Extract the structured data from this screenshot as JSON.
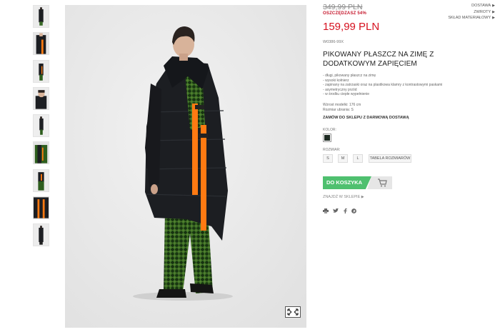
{
  "product": {
    "old_price": "349,99 PLN",
    "savings": "OSZCZĘDZASZ 54%",
    "price": "159,99 PLN",
    "sku": "W0386-99X",
    "title": "PIKOWANY PŁASZCZ NA ZIMĘ Z DODATKOWYM ZAPIĘCIEM",
    "features": [
      "długi, pikowany płaszcz na zimę",
      "wysoki kołnierz",
      "zapinany na zatrzaski oraz na plastikowa klamry z kontrastowymi paskami",
      "asymetryczny przód",
      "w środku ciepłe wypełnienie"
    ],
    "model_height": "Wzrost modelki: 176 cm",
    "model_size": "Rozmiar ubrania: S",
    "order_link": "ZAMÓW DO SKLEPU Z DARMOWĄ DOSTAWĄ"
  },
  "side_links": [
    {
      "label": "DOSTAWA"
    },
    {
      "label": "ZWROTY"
    },
    {
      "label": "SKŁAD MATERIAŁOWY"
    }
  ],
  "color": {
    "label": "KOLOR:",
    "swatch": "#1d2a22"
  },
  "size": {
    "label": "ROZMIAR:",
    "options": [
      "S",
      "M",
      "L"
    ],
    "table_link": "TABELA ROZMIARÓW"
  },
  "cart": {
    "label": "DO KOSZYKA",
    "accent": "#4fc06f"
  },
  "find_store": "ZNAJDŹ W SKLEPIE",
  "share_icons": [
    "print-icon",
    "twitter-icon",
    "facebook-icon",
    "pinterest-icon"
  ],
  "colors": {
    "price_red": "#d6111f",
    "coat": "#1c1e22",
    "strap": "#ff7a12",
    "trousers": "#2e5e1e"
  }
}
